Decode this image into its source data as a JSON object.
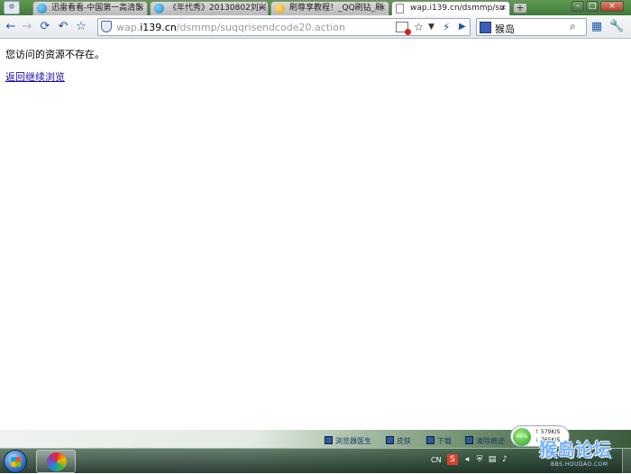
{
  "tabs": [
    {
      "label": "迅雷看看-中国第一高清影",
      "icon": "blue-globe-icon"
    },
    {
      "label": "《年代秀》20130802刘兴",
      "icon": "blue-globe-icon"
    },
    {
      "label": "刷尊享教程！_QQ刷钻_刷",
      "icon": "smiley-icon"
    },
    {
      "label": "wap.i139.cn/dsmmp/su",
      "icon": "page-icon"
    }
  ],
  "tab_close_glyph": "×",
  "new_tab_glyph": "+",
  "window_buttons": {
    "minimize": "–",
    "maximize": "□",
    "close": "×"
  },
  "address": {
    "prefix": "wap.",
    "domain": "i139.cn",
    "path": "/dsmmp/suqqrisendcode20.action"
  },
  "search": {
    "value": "猴岛"
  },
  "page": {
    "message": "您访问的资源不存在。",
    "back_link": "返回继续浏览"
  },
  "gadgets": [
    "浏览器医生",
    "皮肤",
    "下载",
    "清除痕迹"
  ],
  "speed": {
    "percent": "46%",
    "up": "579K/S",
    "down": "765K/S"
  },
  "tray": {
    "lang": "CN"
  },
  "watermark": {
    "title": "猴岛论坛",
    "url": "BBS.HOUDAO.COM"
  },
  "colors": {
    "link": "#1a0dab",
    "tab_strip": "#4f8a46"
  }
}
